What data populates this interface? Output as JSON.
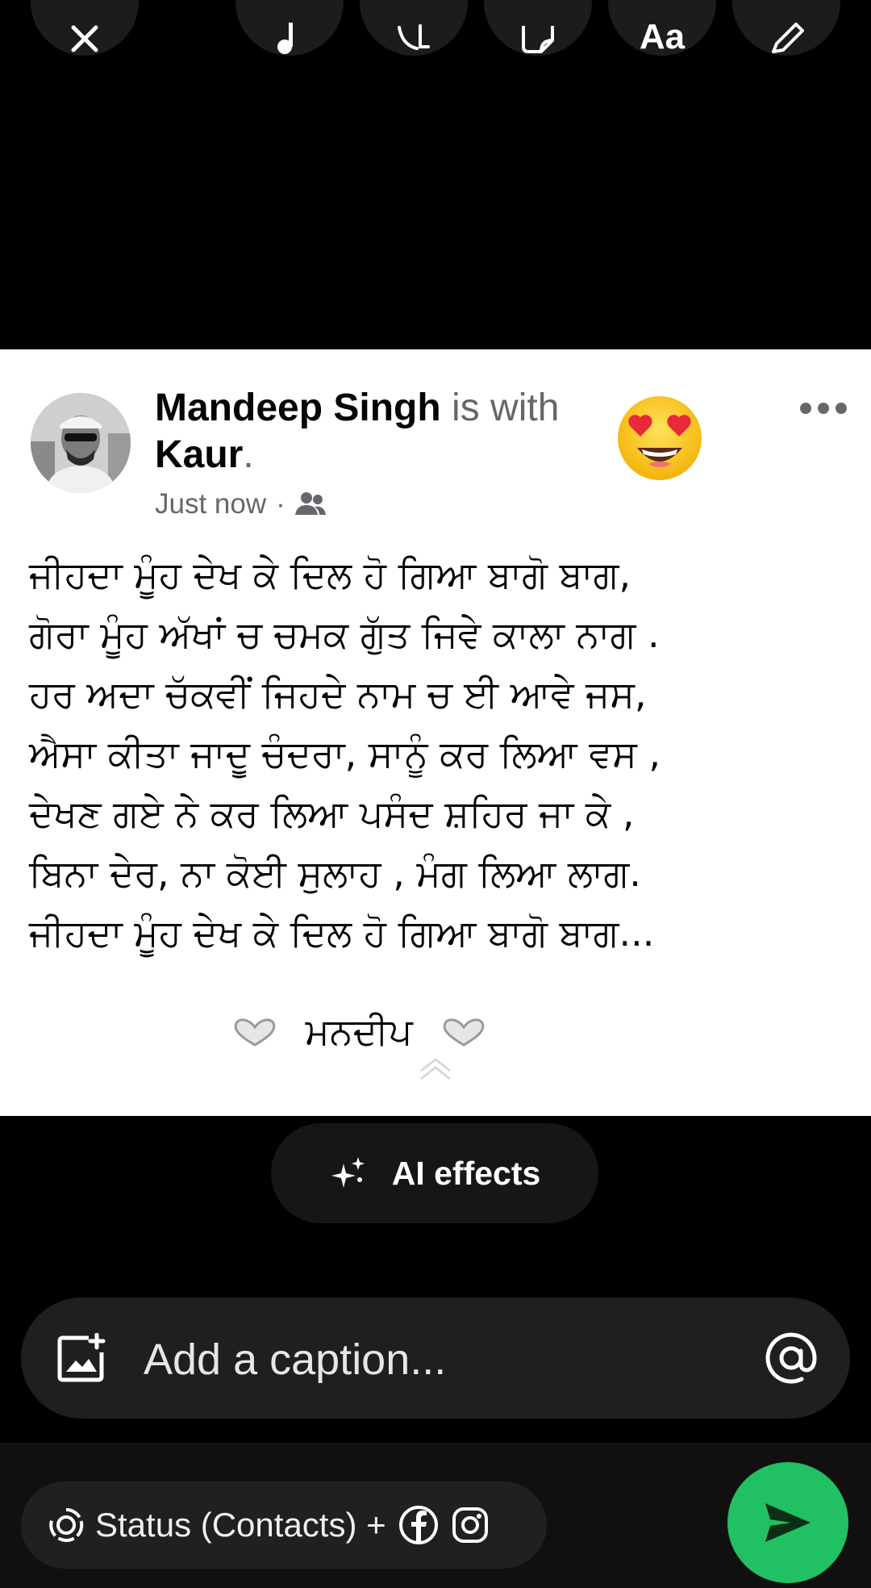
{
  "toolbar": {
    "buttons": [
      "close-icon",
      "music-icon",
      "crop-rotate-icon",
      "sticker-icon",
      "text-icon",
      "pencil-icon"
    ],
    "text_label": "Aa"
  },
  "post": {
    "author": "Mandeep Singh",
    "with_text": "is with",
    "tagged": "Kaur",
    "tagged_suffix": ".",
    "time": "Just now",
    "separator": "·",
    "audience_icon": "friends-icon",
    "reaction_emoji": "heart-eyes-emoji",
    "poem_lines": [
      "ਜੀਹਦਾ ਮੂੰਹ ਦੇਖ ਕੇ ਦਿਲ ਹੋ ਗਿਆ ਬਾਗੋ ਬਾਗ,",
      "ਗੋਰਾ ਮੂੰਹ ਅੱਖਾਂ ਚ ਚਮਕ ਗੁੱਤ ਜਿਵੇ ਕਾਲਾ ਨਾਗ .",
      "ਹਰ ਅਦਾ ਚੱਕਵੀਂ ਜਿਹਦੇ ਨਾਮ ਚ ਈ ਆਵੇ ਜਸ,",
      "ਐਸਾ ਕੀਤਾ ਜਾਦੂ ਚੰਦਰਾ, ਸਾਨੂੰ ਕਰ ਲਿਆ ਵਸ ,",
      "ਦੇਖਣ ਗਏ ਨੇ ਕਰ ਲਿਆ ਪਸੰਦ ਸ਼ਹਿਰ ਜਾ ਕੇ ,",
      "ਬਿਨਾ ਦੇਰ, ਨਾ ਕੋਈ ਸੁਲਾਹ , ਮੰਗ ਲਿਆ ਲਾਗ.",
      "ਜੀਹਦਾ ਮੂੰਹ ਦੇਖ ਕੇ ਦਿਲ ਹੋ ਗਿਆ ਬਾਗੋ ਬਾਗ..."
    ],
    "signature": "ਮਨਦੀਪ"
  },
  "ai_effects": {
    "label": "AI effects",
    "icon": "sparkles-icon"
  },
  "caption": {
    "placeholder": "Add a caption...",
    "gallery_icon": "add-photo-icon",
    "mention_icon": "at-icon"
  },
  "share": {
    "label": "Status (Contacts) +",
    "icons": [
      "status-icon",
      "facebook-icon",
      "instagram-icon"
    ]
  },
  "colors": {
    "send": "#21c063",
    "background": "#000000",
    "card": "#ffffff"
  }
}
